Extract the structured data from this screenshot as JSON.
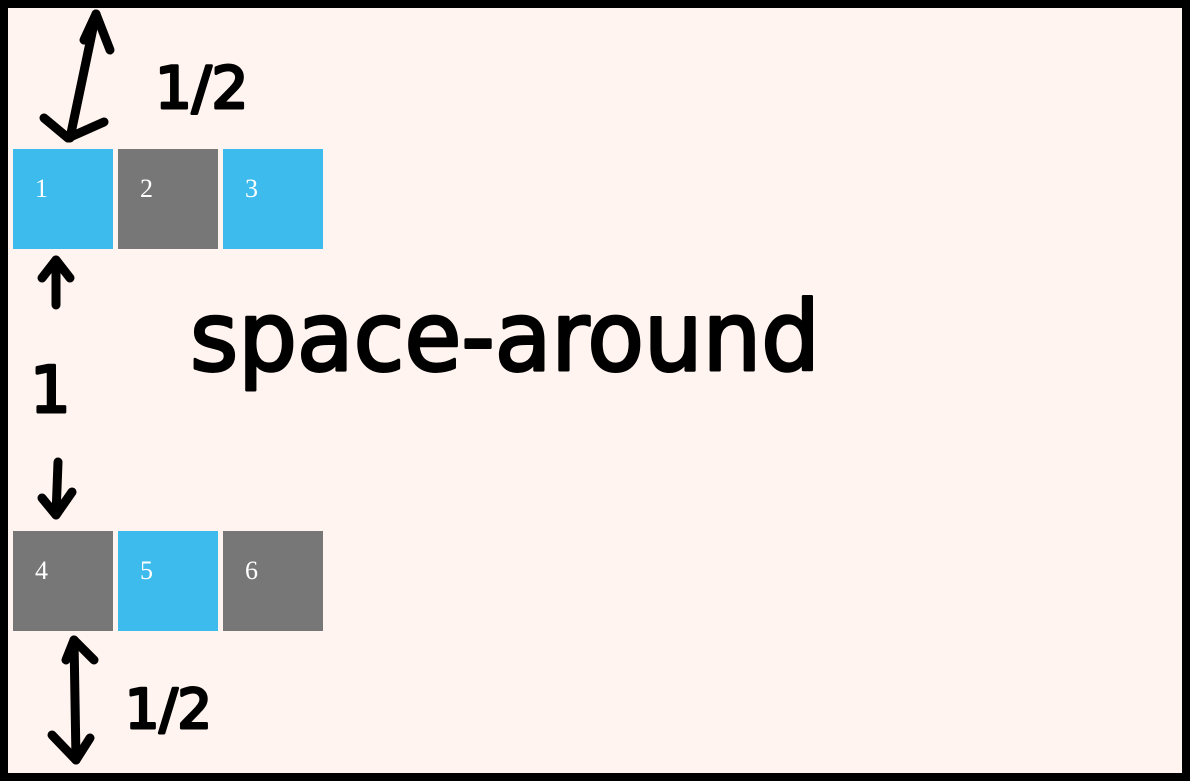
{
  "title": "space-around",
  "boxes": [
    {
      "label": "1",
      "color": "#3dbbec"
    },
    {
      "label": "2",
      "color": "#777777"
    },
    {
      "label": "3",
      "color": "#3dbbec"
    },
    {
      "label": "4",
      "color": "#777777"
    },
    {
      "label": "5",
      "color": "#3dbbec"
    },
    {
      "label": "6",
      "color": "#777777"
    }
  ],
  "annotations": {
    "top_gap": "1/2",
    "middle_gap": "1",
    "bottom_gap": "1/2"
  },
  "colors": {
    "background": "#fff4ef",
    "border": "#000000"
  }
}
